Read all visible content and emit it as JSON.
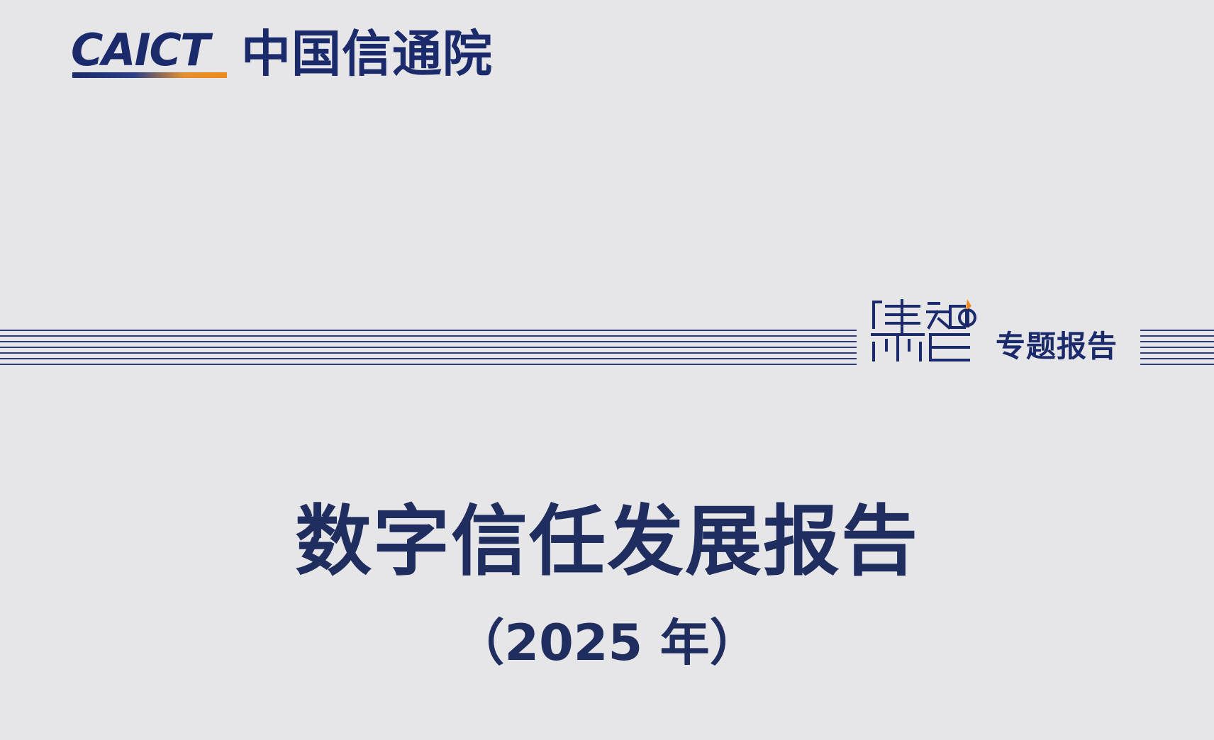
{
  "header": {
    "logo_en": "CAICT",
    "logo_cn": "中国信通院"
  },
  "series": {
    "mark_label": "集智",
    "label": "专题报告"
  },
  "report": {
    "title": "数字信任发展报告",
    "subtitle": "（2025 年）"
  },
  "colors": {
    "background": "#e6e6e8",
    "primary": "#1b2a6b",
    "title": "#1f2d5f",
    "accent": "#f08a1c"
  }
}
